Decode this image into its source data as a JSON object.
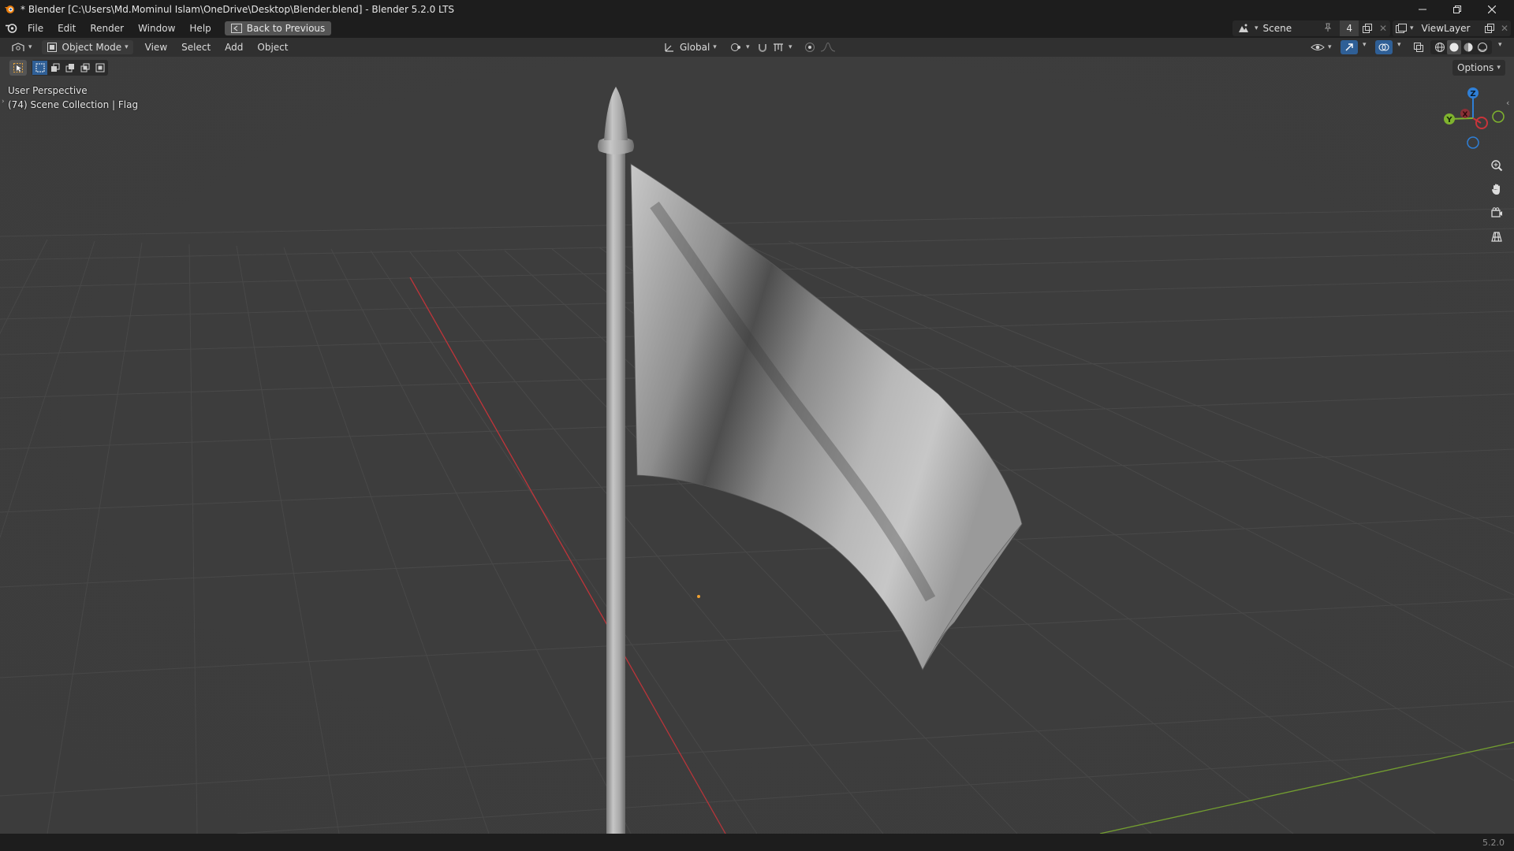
{
  "window": {
    "title": "* Blender [C:\\Users\\Md.Mominul Islam\\OneDrive\\Desktop\\Blender.blend] - Blender 5.2.0 LTS"
  },
  "menu": {
    "items": [
      "File",
      "Edit",
      "Render",
      "Window",
      "Help"
    ],
    "back_button": "Back to Previous"
  },
  "scene": {
    "name": "Scene",
    "users": "4"
  },
  "view_layer": {
    "name": "ViewLayer"
  },
  "viewport_header": {
    "mode": "Object Mode",
    "menus": [
      "View",
      "Select",
      "Add",
      "Object"
    ],
    "transform_orientation": "Global",
    "options_label": "Options"
  },
  "viewport": {
    "perspective_label": "User Perspective",
    "collection_info": "(74) Scene Collection | Flag",
    "gizmo_axes": {
      "x": "X",
      "y": "Y",
      "z": "Z"
    }
  },
  "status": {
    "version": "5.2.0"
  },
  "colors": {
    "x_axis": "#c9343a",
    "y_axis": "#7fb32e",
    "z_axis": "#2f7fd6",
    "background": "#3d3d3d",
    "panel": "#1d1d1d"
  },
  "icons": {
    "app": "blender-logo-icon",
    "tools": [
      "select-box-icon",
      "select-new-icon",
      "select-extend-icon",
      "select-subtract-icon",
      "select-intersect-icon"
    ],
    "navigation": [
      "zoom-icon",
      "pan-hand-icon",
      "camera-view-icon",
      "grid-ortho-icon"
    ]
  }
}
